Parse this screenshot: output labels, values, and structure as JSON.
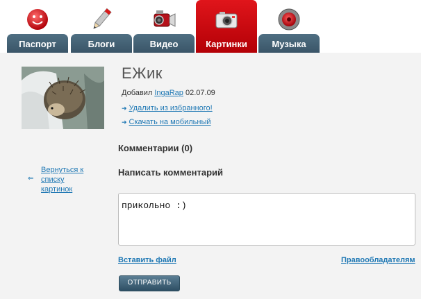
{
  "nav": {
    "tabs": [
      {
        "label": "Паспорт",
        "icon": "smiley-icon",
        "active": false
      },
      {
        "label": "Блоги",
        "icon": "pencil-icon",
        "active": false
      },
      {
        "label": "Видео",
        "icon": "video-camera-icon",
        "active": false
      },
      {
        "label": "Картинки",
        "icon": "photo-camera-icon",
        "active": true
      },
      {
        "label": "Музыка",
        "icon": "speaker-icon",
        "active": false
      }
    ]
  },
  "picture": {
    "title": "ЕЖик",
    "added_prefix": "Добавил",
    "author": "IngaRap",
    "date": "02.07.09",
    "remove_favorite": "Удалить из избранного!",
    "download_mobile": "Скачать на мобильный"
  },
  "comments": {
    "count_heading": "Комментарии (0)",
    "write_heading": "Написать комментарий",
    "draft": "прикольно :)"
  },
  "sidebar": {
    "back_link": "Вернуться к списку картинок"
  },
  "footer": {
    "attach_file": "Вставить файл",
    "copyright": "Правообладателям",
    "submit": "ОТПРАВИТЬ"
  },
  "colors": {
    "nav_tab": "#3a5568",
    "nav_active": "#d10a10",
    "link": "#1f78b4",
    "background": "#f3f3f3"
  }
}
